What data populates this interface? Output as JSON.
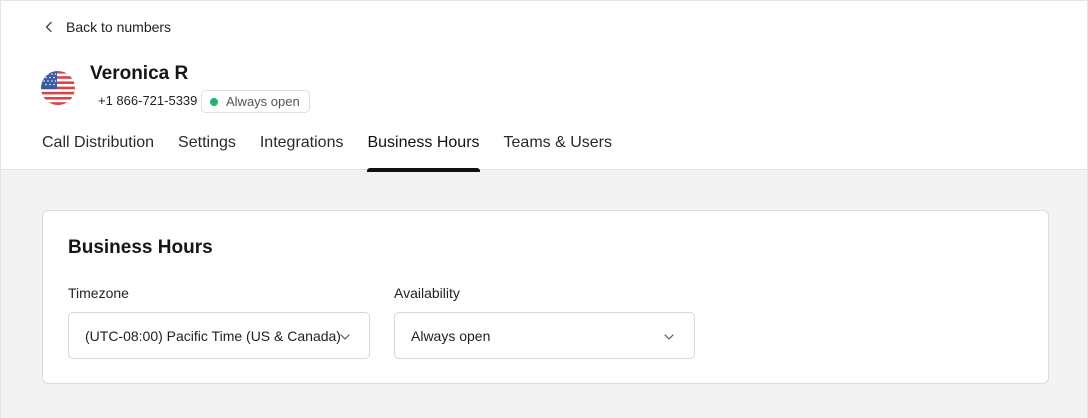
{
  "header": {
    "back_label": "Back to numbers",
    "contact_name": "Veronica R",
    "phone": "+1 866-721-5339",
    "status": {
      "label": "Always open",
      "color": "#1fb66b"
    },
    "flag_icon": "us-flag-icon"
  },
  "tabs": [
    {
      "label": "Call Distribution",
      "active": false
    },
    {
      "label": "Settings",
      "active": false
    },
    {
      "label": "Integrations",
      "active": false
    },
    {
      "label": "Business Hours",
      "active": true
    },
    {
      "label": "Teams & Users",
      "active": false
    }
  ],
  "business_hours": {
    "title": "Business Hours",
    "timezone": {
      "label": "Timezone",
      "value": "(UTC-08:00) Pacific Time (US & Canada)"
    },
    "availability": {
      "label": "Availability",
      "value": "Always open"
    }
  }
}
